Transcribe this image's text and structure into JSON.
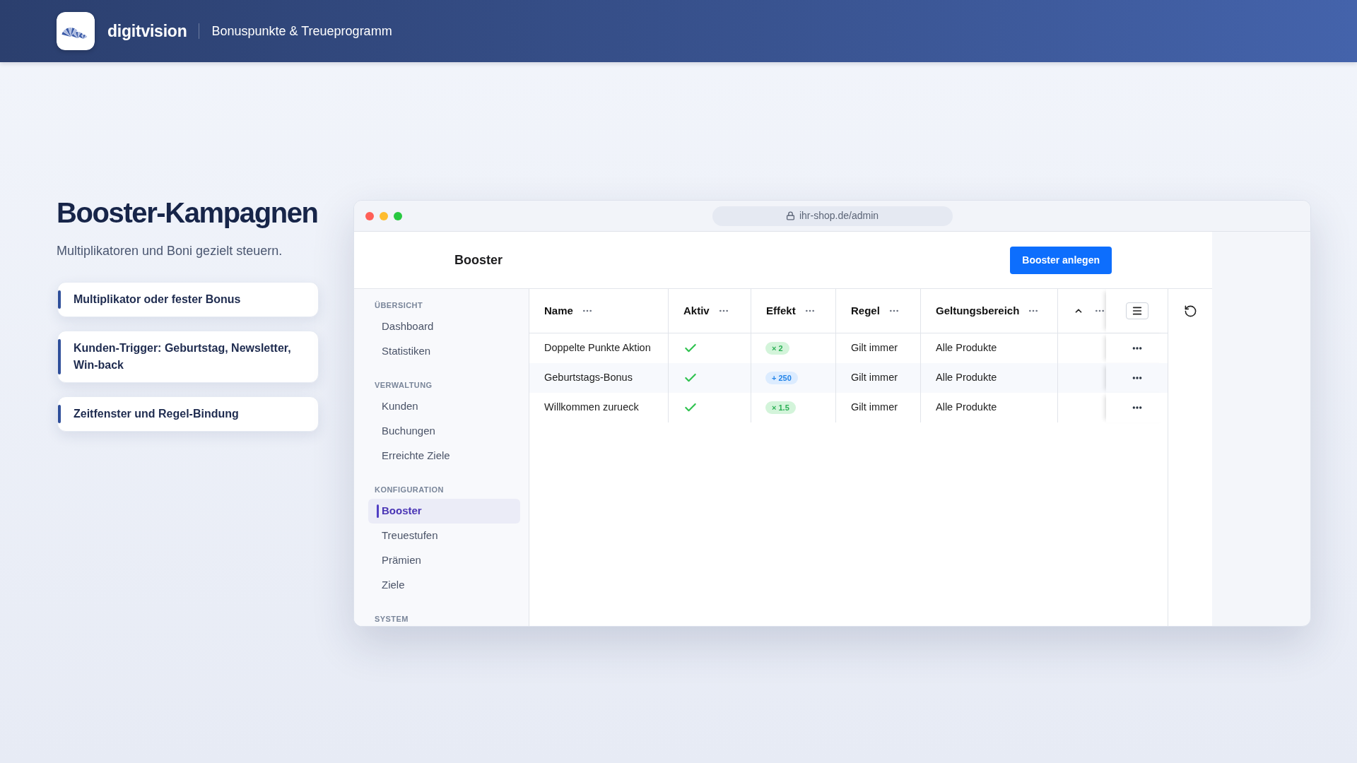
{
  "topbar": {
    "brand": "digitvision",
    "subtitle": "Bonuspunkte & Treueprogramm"
  },
  "hero": {
    "title": "Booster-Kampagnen",
    "subtitle": "Multiplikatoren und Boni gezielt steuern.",
    "features": [
      "Multiplikator oder fester Bonus",
      "Kunden-Trigger: Geburtstag, Newsletter, Win-back",
      "Zeitfenster und Regel-Bindung"
    ]
  },
  "browser": {
    "url": "ihr-shop.de/admin"
  },
  "app": {
    "title": "Booster",
    "primary_button": "Booster anlegen"
  },
  "sidebar": {
    "sections": [
      {
        "heading": "ÜBERSICHT",
        "items": [
          {
            "label": "Dashboard",
            "selected": false
          },
          {
            "label": "Statistiken",
            "selected": false
          }
        ]
      },
      {
        "heading": "VERWALTUNG",
        "items": [
          {
            "label": "Kunden",
            "selected": false
          },
          {
            "label": "Buchungen",
            "selected": false
          },
          {
            "label": "Erreichte Ziele",
            "selected": false
          }
        ]
      },
      {
        "heading": "KONFIGURATION",
        "items": [
          {
            "label": "Booster",
            "selected": true
          },
          {
            "label": "Treuestufen",
            "selected": false
          },
          {
            "label": "Prämien",
            "selected": false
          },
          {
            "label": "Ziele",
            "selected": false
          }
        ]
      },
      {
        "heading": "SYSTEM"
      }
    ]
  },
  "table": {
    "columns": [
      {
        "label": "Name"
      },
      {
        "label": "Aktiv"
      },
      {
        "label": "Effekt"
      },
      {
        "label": "Regel"
      },
      {
        "label": "Geltungsbereich"
      },
      {
        "ascending": true
      }
    ],
    "rows": [
      {
        "name": "Doppelte Punkte Aktion",
        "active": true,
        "effect": {
          "kind": "multiplier",
          "label": "× 2"
        },
        "rule": "Gilt immer",
        "scope": "Alle Produkte"
      },
      {
        "name": "Geburtstags-Bonus",
        "active": true,
        "effect": {
          "kind": "bonus",
          "label": "+ 250"
        },
        "rule": "Gilt immer",
        "scope": "Alle Produkte"
      },
      {
        "name": "Willkommen zurueck",
        "active": true,
        "effect": {
          "kind": "multiplier",
          "label": "× 1.5"
        },
        "rule": "Gilt immer",
        "scope": "Alle Produkte"
      }
    ]
  }
}
